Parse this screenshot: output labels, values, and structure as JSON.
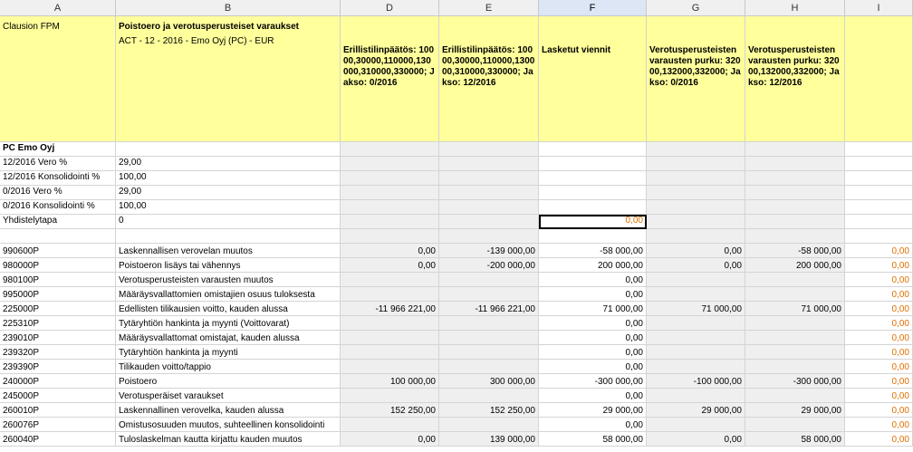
{
  "columns": [
    "A",
    "B",
    "D",
    "E",
    "F",
    "G",
    "H",
    "I"
  ],
  "selected_column": "F",
  "header": {
    "a1": "Clausion FPM",
    "b1": "Poistoero ja verotusperusteiset varaukset",
    "b2": "ACT - 12 - 2016 - Emo Oyj (PC) - EUR",
    "d": "Erillistilinpäätös: 10000,30000,110000,130000,310000,330000; Jakso: 0/2016",
    "e": "Erillistilinpäätös: 10000,30000,110000,130000,310000,330000; Jakso: 12/2016",
    "f": "Lasketut viennit",
    "g": "Verotusperusteisten varausten purku: 32000,132000,332000; Jakso: 0/2016",
    "h": "Verotusperusteisten varausten purku: 32000,132000,332000; Jakso: 12/2016"
  },
  "company": "PC Emo Oyj",
  "params": [
    {
      "label": "12/2016 Vero %",
      "value": "29,00"
    },
    {
      "label": "12/2016 Konsolidointi %",
      "value": "100,00"
    },
    {
      "label": "0/2016 Vero %",
      "value": "29,00"
    },
    {
      "label": "0/2016 Konsolidointi %",
      "value": "100,00"
    },
    {
      "label": "Yhdistelytapa",
      "value": "0",
      "f": "0,00"
    }
  ],
  "rows": [
    {
      "code": "990600P",
      "desc": "Laskennallisen verovelan muutos",
      "d": "0,00",
      "e": "-139 000,00",
      "f": "-58 000,00",
      "g": "0,00",
      "h": "-58 000,00",
      "i": "0,00"
    },
    {
      "code": "980000P",
      "desc": "Poistoeron lisäys tai vähennys",
      "d": "0,00",
      "e": "-200 000,00",
      "f": "200 000,00",
      "g": "0,00",
      "h": "200 000,00",
      "i": "0,00"
    },
    {
      "code": "980100P",
      "desc": "Verotusperusteisten varausten muutos",
      "d": "",
      "e": "",
      "f": "0,00",
      "g": "",
      "h": "",
      "i": "0,00"
    },
    {
      "code": "995000P",
      "desc": "Määräysvallattomien omistajien osuus tuloksesta",
      "d": "",
      "e": "",
      "f": "0,00",
      "g": "",
      "h": "",
      "i": "0,00"
    },
    {
      "code": "225000P",
      "desc": "Edellisten tilikausien voitto, kauden alussa",
      "d": "-11 966 221,00",
      "e": "-11 966 221,00",
      "f": "71 000,00",
      "g": "71 000,00",
      "h": "71 000,00",
      "i": "0,00"
    },
    {
      "code": "225310P",
      "desc": "Tytäryhtiön hankinta ja myynti (Voittovarat)",
      "d": "",
      "e": "",
      "f": "0,00",
      "g": "",
      "h": "",
      "i": "0,00"
    },
    {
      "code": "239010P",
      "desc": "Määräysvallattomat omistajat, kauden alussa",
      "d": "",
      "e": "",
      "f": "0,00",
      "g": "",
      "h": "",
      "i": "0,00"
    },
    {
      "code": "239320P",
      "desc": "Tytäryhtiön hankinta ja myynti",
      "d": "",
      "e": "",
      "f": "0,00",
      "g": "",
      "h": "",
      "i": "0,00"
    },
    {
      "code": "239390P",
      "desc": "Tilikauden voitto/tappio",
      "d": "",
      "e": "",
      "f": "0,00",
      "g": "",
      "h": "",
      "i": "0,00"
    },
    {
      "code": "240000P",
      "desc": "Poistoero",
      "d": "100 000,00",
      "e": "300 000,00",
      "f": "-300 000,00",
      "g": "-100 000,00",
      "h": "-300 000,00",
      "i": "0,00"
    },
    {
      "code": "245000P",
      "desc": "Verotusperäiset varaukset",
      "d": "",
      "e": "",
      "f": "0,00",
      "g": "",
      "h": "",
      "i": "0,00"
    },
    {
      "code": "260010P",
      "desc": "Laskennallinen verovelka, kauden alussa",
      "d": "152 250,00",
      "e": "152 250,00",
      "f": "29 000,00",
      "g": "29 000,00",
      "h": "29 000,00",
      "i": "0,00"
    },
    {
      "code": "260076P",
      "desc": "Omistusosuuden muutos, suhteellinen konsolidointi",
      "d": "",
      "e": "",
      "f": "0,00",
      "g": "",
      "h": "",
      "i": "0,00"
    },
    {
      "code": "260040P",
      "desc": "Tuloslaskelman kautta kirjattu kauden muutos",
      "d": "0,00",
      "e": "139 000,00",
      "f": "58 000,00",
      "g": "0,00",
      "h": "58 000,00",
      "i": "0,00"
    }
  ]
}
